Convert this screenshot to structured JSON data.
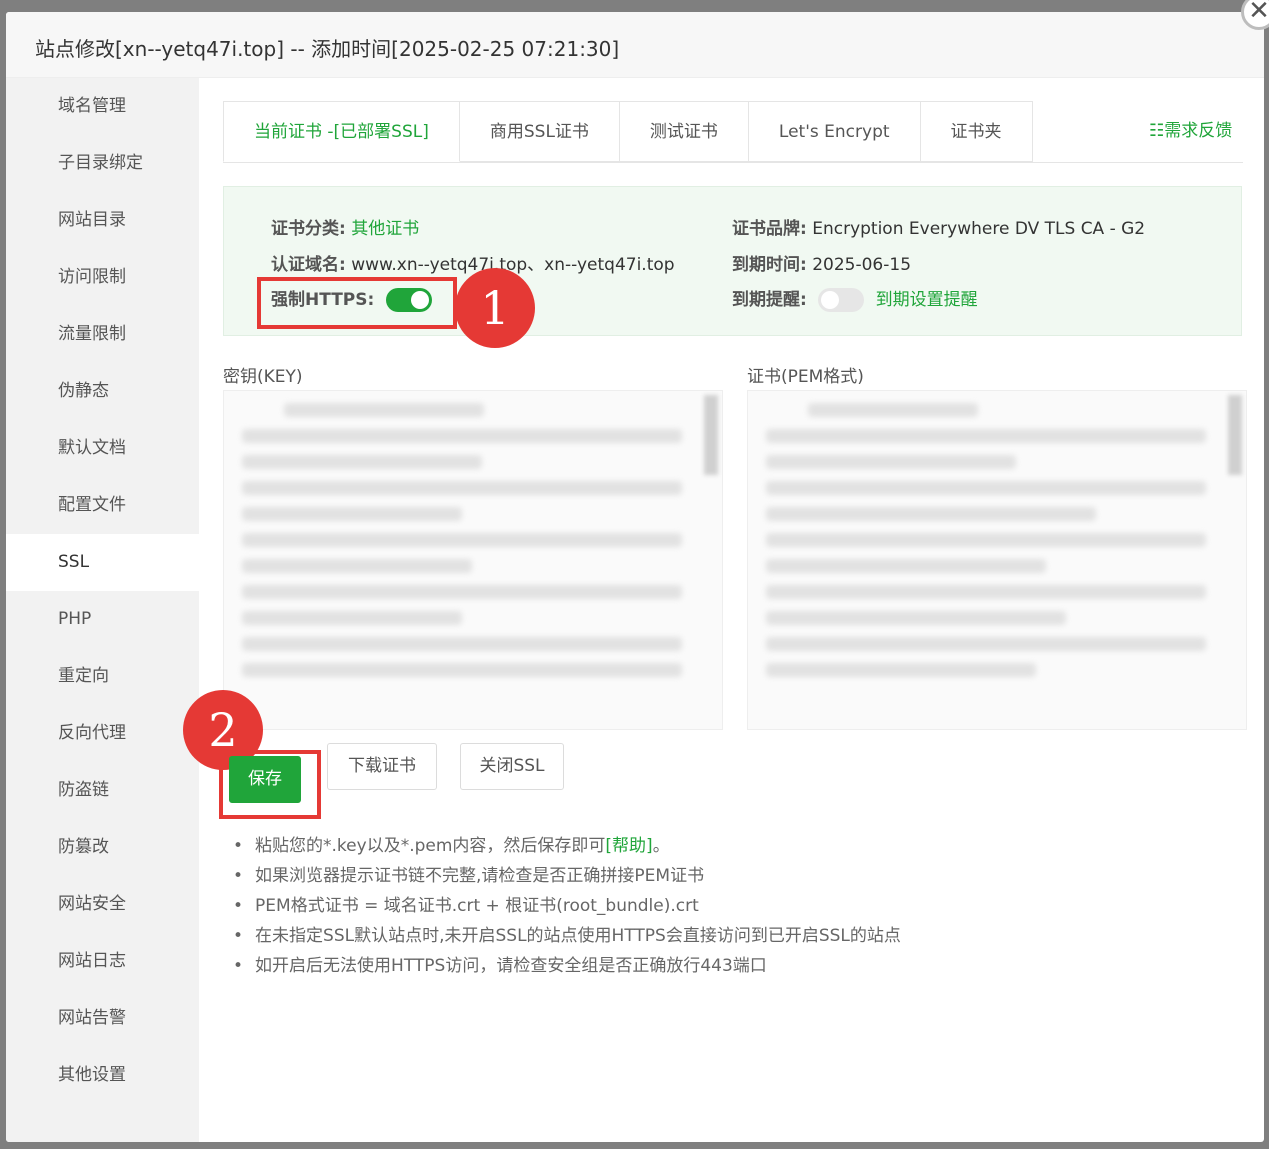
{
  "dialog": {
    "title": "站点修改[xn--yetq47i.top] -- 添加时间[2025-02-25 07:21:30]",
    "close_glyph": "✕"
  },
  "sidebar": {
    "items": [
      {
        "label": "域名管理"
      },
      {
        "label": "子目录绑定"
      },
      {
        "label": "网站目录"
      },
      {
        "label": "访问限制"
      },
      {
        "label": "流量限制"
      },
      {
        "label": "伪静态"
      },
      {
        "label": "默认文档"
      },
      {
        "label": "配置文件"
      },
      {
        "label": "SSL"
      },
      {
        "label": "PHP"
      },
      {
        "label": "重定向"
      },
      {
        "label": "反向代理"
      },
      {
        "label": "防盗链"
      },
      {
        "label": "防篡改"
      },
      {
        "label": "网站安全"
      },
      {
        "label": "网站日志"
      },
      {
        "label": "网站告警"
      },
      {
        "label": "其他设置"
      }
    ],
    "active": "SSL"
  },
  "tabs": [
    {
      "label": "当前证书 -[已部署SSL]"
    },
    {
      "label": "商用SSL证书"
    },
    {
      "label": "测试证书"
    },
    {
      "label": "Let's Encrypt"
    },
    {
      "label": "证书夹"
    }
  ],
  "feedback_label": "需求反馈",
  "cert_info": {
    "category_label": "证书分类:",
    "category_value": "其他证书",
    "brand_label": "证书品牌:",
    "brand_value": "Encryption Everywhere DV TLS CA - G2",
    "domain_label": "认证域名:",
    "domain_value": "www.xn--yetq47i.top、xn--yetq47i.top",
    "expiry_label": "到期时间:",
    "expiry_value": "2025-06-15",
    "force_https_label": "强制HTTPS:",
    "force_https_on": true,
    "reminder_label": "到期提醒:",
    "reminder_on": false,
    "reminder_link": "到期设置提醒"
  },
  "key_label": "密钥(KEY)",
  "pem_label": "证书(PEM格式)",
  "buttons": {
    "save": "保存",
    "download": "下载证书",
    "close_ssl": "关闭SSL"
  },
  "badges": {
    "one": "1",
    "two": "2"
  },
  "tips": {
    "tip1_prefix": "粘贴您的*.key以及*.pem内容，然后保存即可",
    "tip1_link": "[帮助]",
    "tip1_suffix": "。",
    "tip2": "如果浏览器提示证书链不完整,请检查是否正确拼接PEM证书",
    "tip3": "PEM格式证书 = 域名证书.crt + 根证书(root_bundle).crt",
    "tip4": "在未指定SSL默认站点时,未开启SSL的站点使用HTTPS会直接访问到已开启SSL的站点",
    "tip5": "如开启后无法使用HTTPS访问，请检查安全组是否正确放行443端口"
  }
}
